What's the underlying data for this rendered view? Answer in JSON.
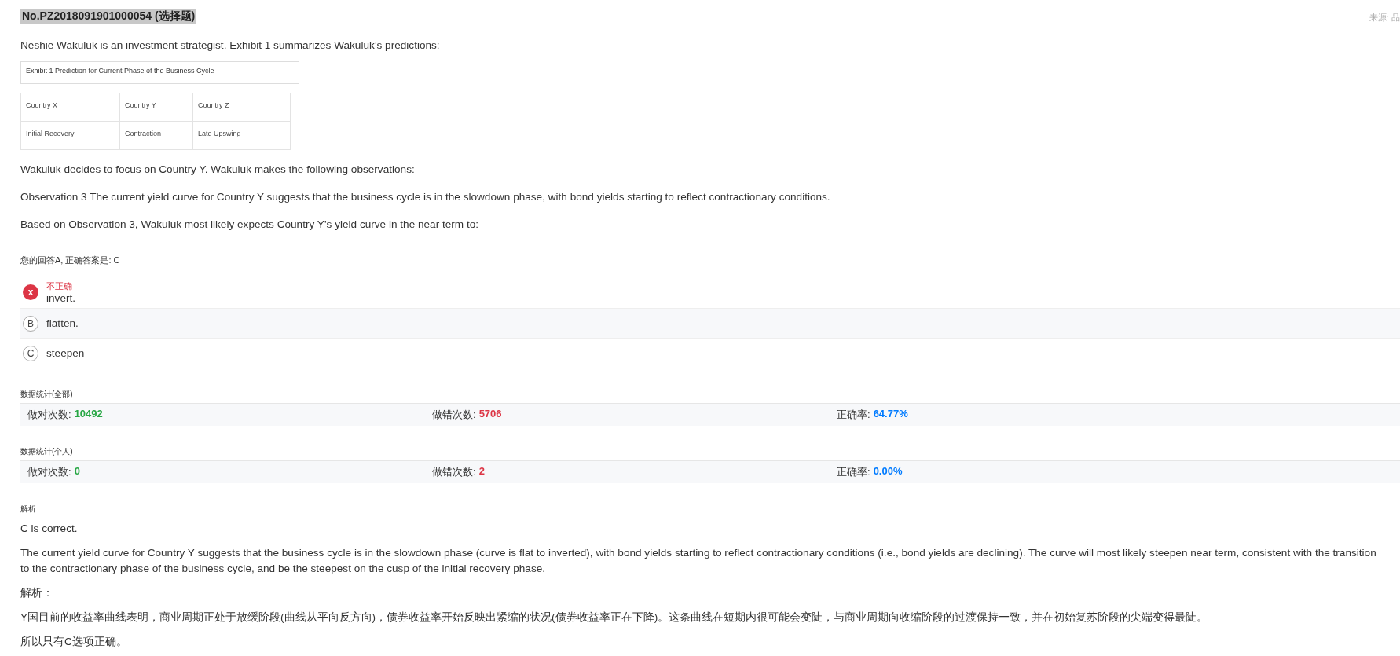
{
  "header": {
    "title": "No.PZ2018091901000054 (选择题)",
    "source": "来源: 品"
  },
  "question": {
    "intro": "Neshie Wakuluk is an investment strategist. Exhibit 1 summarizes Wakuluk’s predictions:",
    "exhibit": {
      "caption": "Exhibit 1 Prediction for Current Phase of the Business Cycle",
      "rows": [
        [
          "Country X",
          "Country Y",
          "Country Z"
        ],
        [
          "Initial Recovery",
          "Contraction",
          "Late Upswing"
        ]
      ]
    },
    "paragraphs": [
      "Wakuluk decides to focus on Country Y. Wakuluk makes the following observations:",
      "Observation 3 The current yield curve for Country Y suggests that the business cycle is in the slowdown phase, with bond yields starting to reflect contractionary conditions.",
      "Based on Observation 3, Wakuluk most likely expects Country Y’s yield curve in the near term to:"
    ]
  },
  "answer_summary": "您的回答A, 正确答案是: C",
  "options": [
    {
      "marker": "x",
      "text": "invert.",
      "selected": true,
      "verdict": "不正确"
    },
    {
      "marker": "B",
      "text": "flatten.",
      "selected": false
    },
    {
      "marker": "C",
      "text": "steepen",
      "selected": false
    }
  ],
  "stats": [
    {
      "title": "数据统计(全部)",
      "items": [
        {
          "label": "做对次数:",
          "value": "10492",
          "color": "#28a745"
        },
        {
          "label": "做错次数:",
          "value": "5706",
          "color": "#dc3545"
        },
        {
          "label": "正确率:",
          "value": "64.77%",
          "color": "#007bff"
        }
      ]
    },
    {
      "title": "数据统计(个人)",
      "items": [
        {
          "label": "做对次数:",
          "value": "0",
          "color": "#28a745"
        },
        {
          "label": "做错次数:",
          "value": "2",
          "color": "#dc3545"
        },
        {
          "label": "正确率:",
          "value": "0.00%",
          "color": "#007bff"
        }
      ]
    }
  ],
  "analysis": {
    "title": "解析",
    "paragraphs": [
      "C is correct.",
      "The current yield curve for Country Y suggests that the business cycle is in the slowdown phase (curve is flat to inverted), with bond yields starting to reflect contractionary conditions (i.e., bond yields are declining). The curve will most likely steepen near term, consistent with the transition to the contractionary phase of the business cycle, and be the steepest on the cusp of the initial recovery phase.",
      "解析：",
      "Y国目前的收益率曲线表明，商业周期正处于放缓阶段(曲线从平向反方向)，债券收益率开始反映出紧缩的状况(债券收益率正在下降)。这条曲线在短期内很可能会变陡，与商业周期向收缩阶段的过渡保持一致，并在初始复苏阶段的尖端变得最陡。",
      "所以只有C选项正确。"
    ]
  }
}
